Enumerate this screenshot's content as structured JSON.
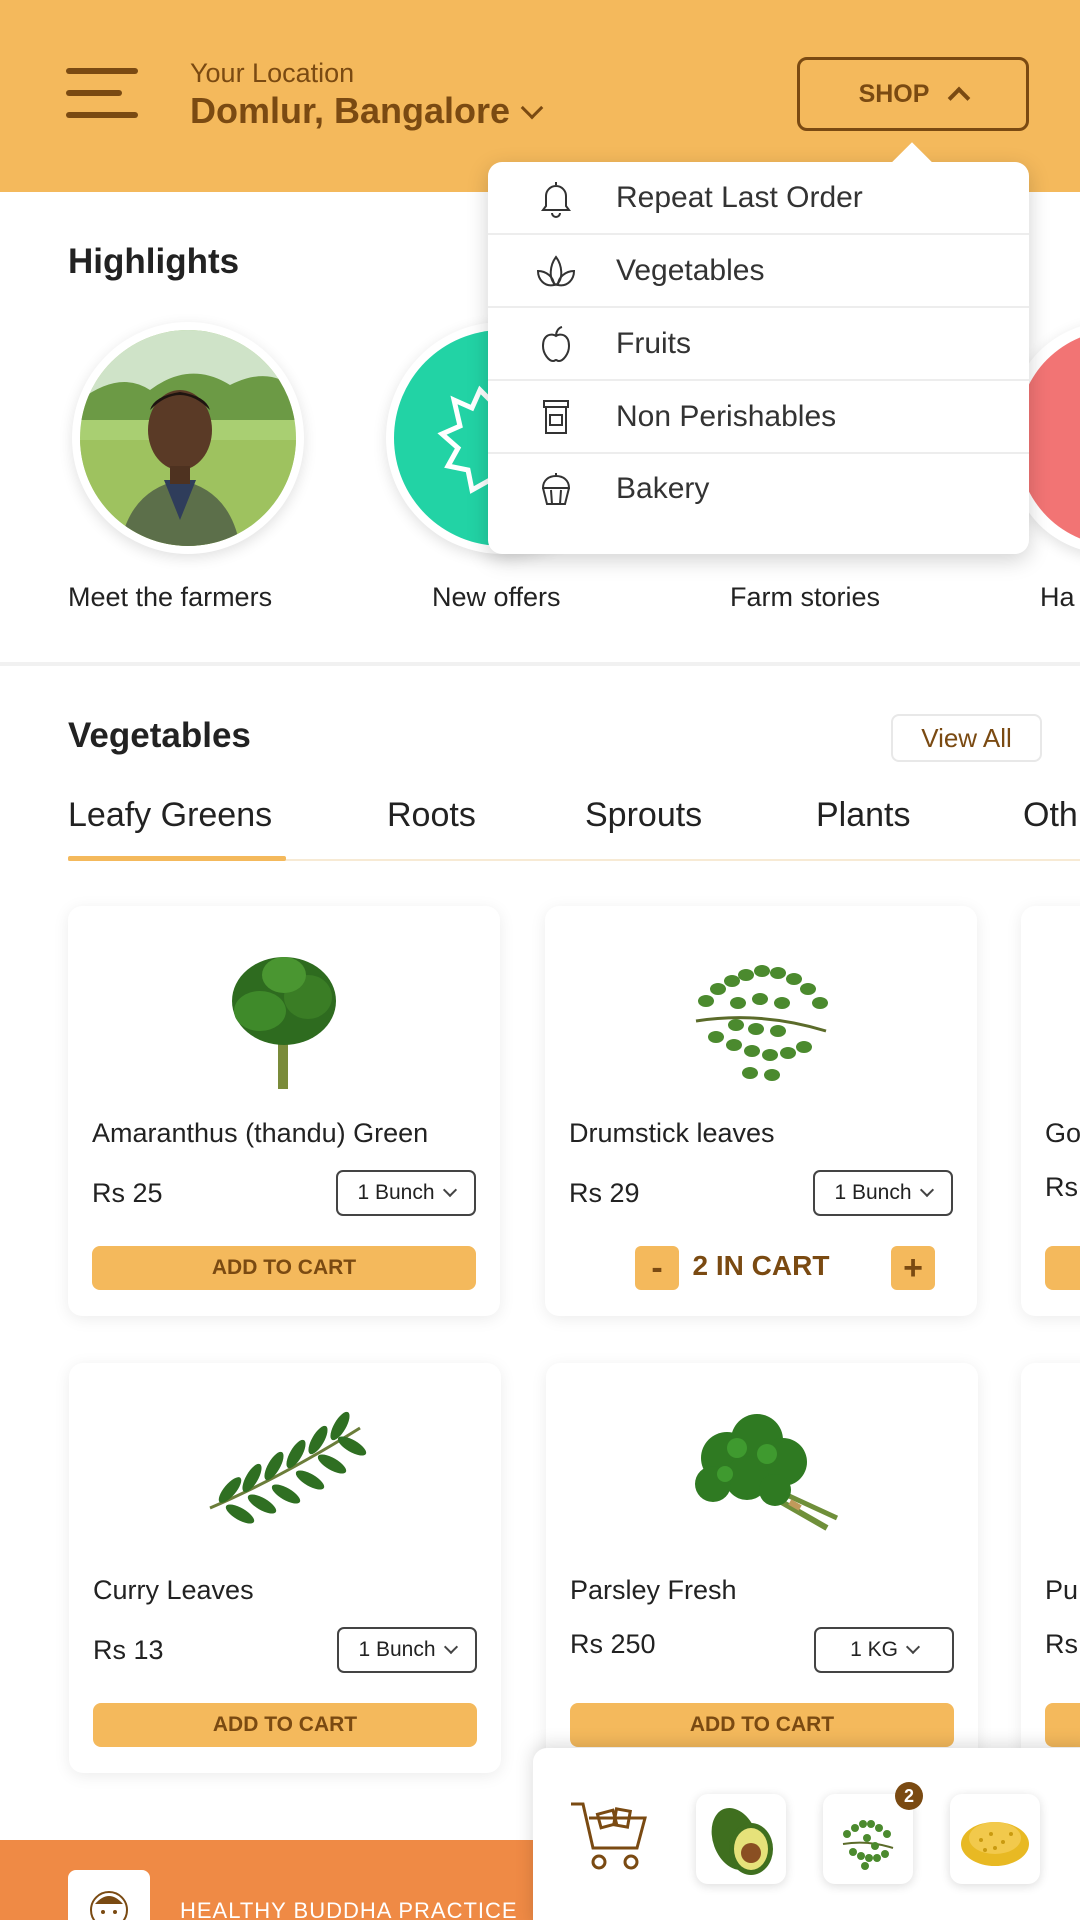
{
  "colors": {
    "header_bg": "#f4b95c",
    "accent_dark": "#7a4a12",
    "banner": "#ef8a45"
  },
  "header": {
    "location_label": "Your Location",
    "location_value": "Domlur, Bangalore",
    "shop_label": "SHOP"
  },
  "shop_menu": [
    {
      "label": "Repeat Last Order",
      "icon": "bell-icon"
    },
    {
      "label": "Vegetables",
      "icon": "leaves-icon"
    },
    {
      "label": "Fruits",
      "icon": "apple-icon"
    },
    {
      "label": "Non Perishables",
      "icon": "jar-icon"
    },
    {
      "label": "Bakery",
      "icon": "cupcake-icon"
    }
  ],
  "highlights": {
    "title": "Highlights",
    "items": [
      {
        "label": "Meet the farmers"
      },
      {
        "label": "New offers"
      },
      {
        "label": "Farm stories"
      },
      {
        "label": "Ha"
      }
    ]
  },
  "vegetables": {
    "title": "Vegetables",
    "view_all": "View All",
    "tabs": [
      "Leafy Greens",
      "Roots",
      "Sprouts",
      "Plants",
      "Oth"
    ],
    "active_tab": "Leafy Greens",
    "products": [
      {
        "name": "Amaranthus (thandu) Green",
        "price": "Rs 25",
        "unit": "1 Bunch",
        "action": "ADD TO CART"
      },
      {
        "name": "Drumstick leaves",
        "price": "Rs 29",
        "unit": "1 Bunch",
        "in_cart": "2 IN CART",
        "minus": "-",
        "plus": "+"
      },
      {
        "name": "Curry Leaves",
        "price": "Rs 13",
        "unit": "1 Bunch",
        "action": "ADD TO CART"
      },
      {
        "name": "Parsley Fresh",
        "price": "Rs 250",
        "unit": "1 KG",
        "action": "ADD TO CART"
      }
    ],
    "partial_products": [
      {
        "name": "Go",
        "price": "Rs"
      },
      {
        "name": "Pu",
        "price": "Rs"
      }
    ]
  },
  "banner": {
    "text": "HEALTHY BUDDHA PRACTICE"
  },
  "cart_tray": {
    "badge_count": "2"
  }
}
